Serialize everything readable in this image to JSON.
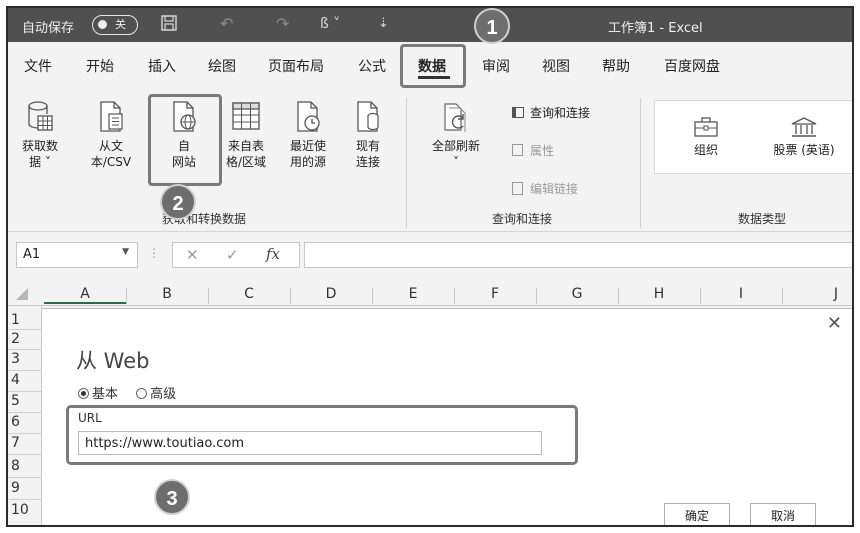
{
  "titlebar": {
    "autosave_label": "自动保存",
    "autosave_toggle": "关",
    "document_title": "工作簿1  -  Excel"
  },
  "badges": [
    "1",
    "2",
    "3"
  ],
  "tabs": [
    {
      "label": "文件"
    },
    {
      "label": "开始"
    },
    {
      "label": "插入"
    },
    {
      "label": "绘图"
    },
    {
      "label": "页面布局"
    },
    {
      "label": "公式"
    },
    {
      "label": "数据"
    },
    {
      "label": "审阅"
    },
    {
      "label": "视图"
    },
    {
      "label": "帮助"
    },
    {
      "label": "百度网盘"
    }
  ],
  "ribbon": {
    "get_transform": {
      "buttons": [
        {
          "line1": "获取数",
          "line2": "据 ˅"
        },
        {
          "line1": "从文",
          "line2": "本/CSV"
        },
        {
          "line1": "自",
          "line2": "网站"
        },
        {
          "line1": "来自表",
          "line2": "格/区域"
        },
        {
          "line1": "最近使",
          "line2": "用的源"
        },
        {
          "line1": "现有",
          "line2": "连接"
        }
      ],
      "group_label": "获取和转换数据"
    },
    "queries": {
      "refresh_all": "全部刷新",
      "refresh_caret": "˅",
      "queries_connections": "查询和连接",
      "properties": "属性",
      "edit_links": "编辑链接",
      "group_label": "查询和连接"
    },
    "data_types": {
      "organization": "组织",
      "stocks": "股票 (英语)",
      "group_label": "数据类型"
    }
  },
  "formula_bar": {
    "name_box": "A1",
    "cancel": "✕",
    "enter": "✓",
    "fx": "fx",
    "formula": ""
  },
  "columns": [
    "A",
    "B",
    "C",
    "D",
    "E",
    "F",
    "G",
    "H",
    "I",
    "J"
  ],
  "rows": [
    "1",
    "2",
    "3",
    "4",
    "5",
    "6",
    "7",
    "8",
    "9",
    "10"
  ],
  "dialog": {
    "title": "从 Web",
    "radio_basic": "基本",
    "radio_advanced": "高级",
    "url_label": "URL",
    "url_value": "https://www.toutiao.com",
    "ok_label": "确定",
    "cancel_label": "取消"
  }
}
